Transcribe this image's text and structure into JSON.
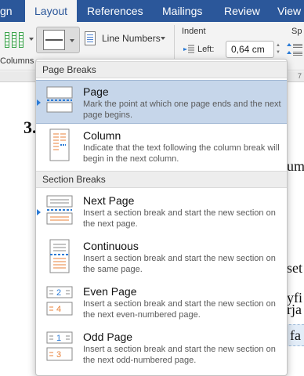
{
  "ribbon": {
    "tabs": [
      {
        "label": "gn"
      },
      {
        "label": "Layout"
      },
      {
        "label": "References"
      },
      {
        "label": "Mailings"
      },
      {
        "label": "Review"
      },
      {
        "label": "View"
      }
    ],
    "columns_label": "Columns",
    "line_numbers_label": "Line Numbers",
    "indent_label": "Indent",
    "left_label": "Left:",
    "left_value": "0,64 cm",
    "spacing_label": "Sp",
    "ruler_number": "7"
  },
  "document": {
    "heading": "3.",
    "text_right_1": "ume",
    "text_right_2": "set",
    "text_right_3": "yfi",
    "text_right_4": "rja",
    "text_right_5": "fa"
  },
  "menu": {
    "page_breaks_header": "Page Breaks",
    "section_breaks_header": "Section Breaks",
    "items": [
      {
        "title": "Page",
        "desc": "Mark the point at which one page ends and the next page begins."
      },
      {
        "title": "Column",
        "desc": "Indicate that the text following the column break will begin in the next column."
      },
      {
        "title": "Next Page",
        "desc": "Insert a section break and start the new section on the next page."
      },
      {
        "title": "Continuous",
        "desc": "Insert a section break and start the new section on the same page."
      },
      {
        "title": "Even Page",
        "desc": "Insert a section break and start the new section on the next even-numbered page."
      },
      {
        "title": "Odd Page",
        "desc": "Insert a section break and start the new section on the next odd-numbered page."
      }
    ],
    "icon_numbers": {
      "even_top": "2",
      "even_bottom": "4",
      "odd_top": "1",
      "odd_bottom": "3"
    }
  },
  "colors": {
    "ribbon_blue": "#2b579a",
    "selection": "#c6d6ea",
    "accent_orange": "#e8823a",
    "accent_blue": "#2b7bd6"
  }
}
